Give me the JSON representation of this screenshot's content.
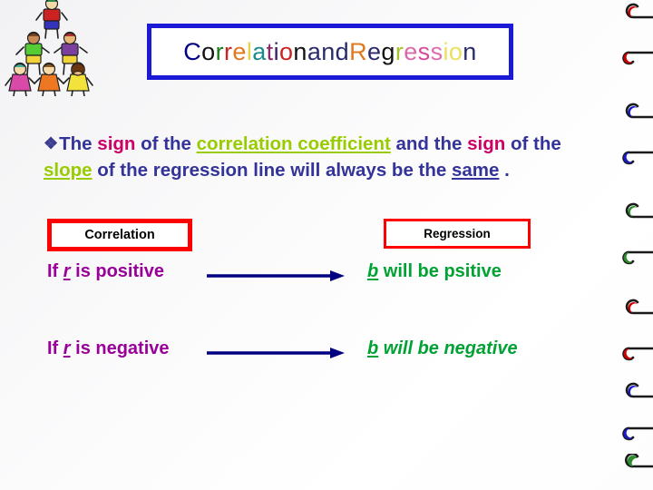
{
  "slide": {
    "background_color": "#fafafb",
    "title": {
      "full_text": "Correlation and Regression",
      "border_color": "#1a1ad6",
      "letters": [
        {
          "ch": "C",
          "color": "#000080"
        },
        {
          "ch": "o",
          "color": "#111111"
        },
        {
          "ch": "r",
          "color": "#1a7a1a"
        },
        {
          "ch": "r",
          "color": "#cc2222"
        },
        {
          "ch": "e",
          "color": "#e07820"
        },
        {
          "ch": "l",
          "color": "#e8d14a"
        },
        {
          "ch": "a",
          "color": "#1a8a8a"
        },
        {
          "ch": "t",
          "color": "#8a2a6a"
        },
        {
          "ch": "i",
          "color": "#3a2060"
        },
        {
          "ch": "o",
          "color": "#cc2222"
        },
        {
          "ch": "n",
          "color": "#111111"
        },
        {
          "ch": " ",
          "color": "transparent"
        },
        {
          "ch": "a",
          "color": "#2b2b6b"
        },
        {
          "ch": "n",
          "color": "#2b2b6b"
        },
        {
          "ch": "d",
          "color": "#2b2b6b"
        },
        {
          "ch": " ",
          "color": "transparent"
        },
        {
          "ch": "R",
          "color": "#e07820"
        },
        {
          "ch": "e",
          "color": "#2b2b6b"
        },
        {
          "ch": "g",
          "color": "#111111"
        },
        {
          "ch": "r",
          "color": "#a8c02a"
        },
        {
          "ch": "e",
          "color": "#d96aa8"
        },
        {
          "ch": "s",
          "color": "#d94a9a"
        },
        {
          "ch": "s",
          "color": "#e06ab0"
        },
        {
          "ch": "i",
          "color": "#ece060"
        },
        {
          "ch": "o",
          "color": "#ece060"
        },
        {
          "ch": "n",
          "color": "#2b2b6b"
        }
      ]
    },
    "body": {
      "bullet_icon": "diamond-bullet",
      "bullet_glyph": "❖",
      "segments": [
        {
          "text": "The ",
          "style": "plain"
        },
        {
          "text": "sign",
          "style": "crimson"
        },
        {
          "text": " of the ",
          "style": "plain"
        },
        {
          "text": "correlation coefficient",
          "style": "green-underline"
        },
        {
          "text": " and the ",
          "style": "plain"
        },
        {
          "text": "sign",
          "style": "crimson"
        },
        {
          "text": " of the ",
          "style": "plain"
        },
        {
          "text": "slope",
          "style": "green-underline"
        },
        {
          "text": " of the regression line will always be the ",
          "style": "plain"
        },
        {
          "text": "same",
          "style": "navy-underline"
        },
        {
          "text": " .",
          "style": "plain"
        }
      ],
      "plain_color": "#333399",
      "crimson_color": "#cc0066",
      "green_color": "#99cc00"
    },
    "headers": {
      "correlation_label": "Correlation",
      "regression_label": "Regression",
      "border_color": "#ff0000"
    },
    "rows": [
      {
        "left_prefix": "If ",
        "left_variable": "r",
        "left_suffix": " is positive",
        "arrow_icon": "right-arrow-icon",
        "arrow_color": "#000080",
        "right_variable": "b",
        "right_suffix": " will be psitive",
        "right_italic": false,
        "left_color": "#990099",
        "right_color": "#00a233"
      },
      {
        "left_prefix": "If ",
        "left_variable": "r",
        "left_suffix": " is negative",
        "arrow_icon": "right-arrow-icon",
        "arrow_color": "#000080",
        "right_variable": "b",
        "right_suffix": " will be negative",
        "right_italic": true,
        "left_color": "#990099",
        "right_color": "#00a233"
      }
    ],
    "decorations": {
      "clipart_name": "children-pyramid-clipart",
      "swirl_name": "swirl-flourish-icon",
      "swirl_colors": [
        "#cc0000",
        "#1a1acc",
        "#2d8a2d"
      ]
    }
  }
}
